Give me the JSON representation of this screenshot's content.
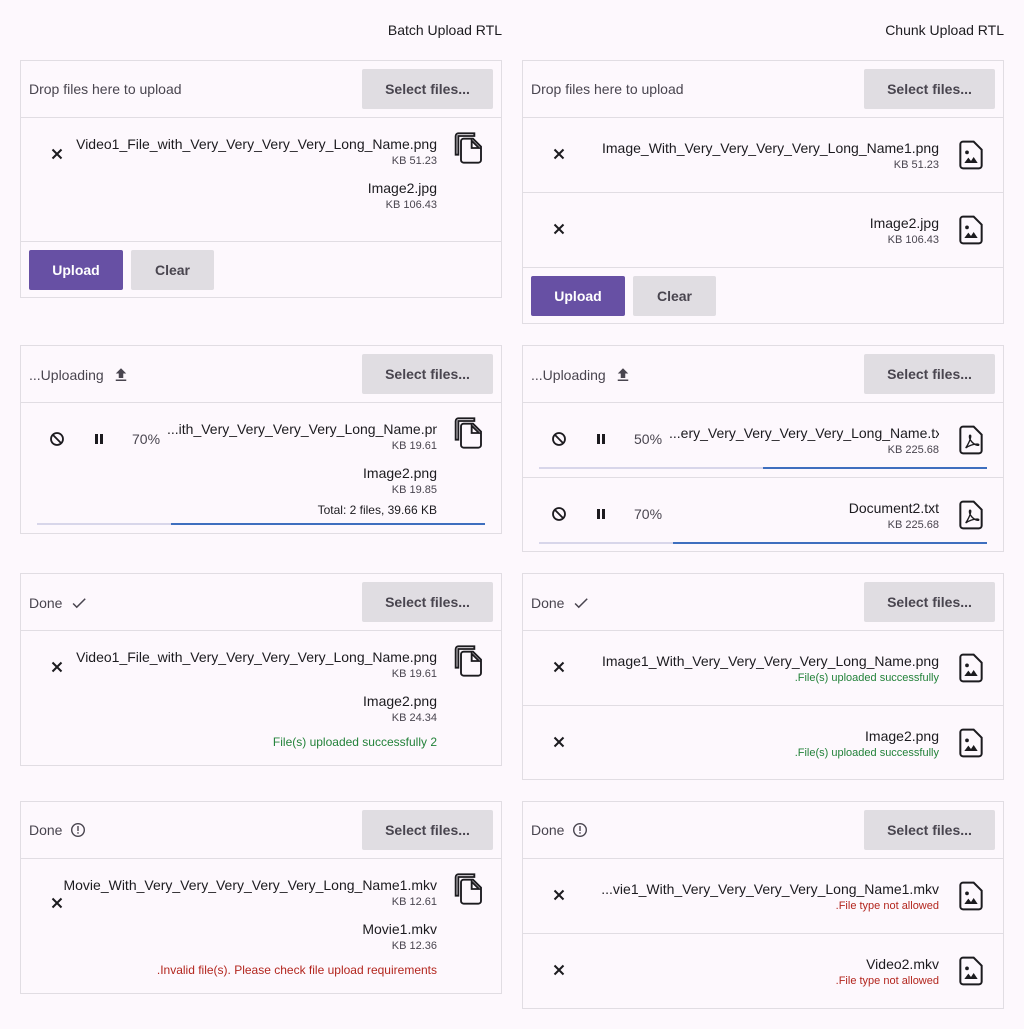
{
  "batch": {
    "title": "Batch Upload RTL",
    "select_label": "Select files...",
    "drop_label": "Drop files here to upload",
    "upload_label": "Upload",
    "clear_label": "Clear",
    "card1": {
      "files": [
        {
          "name": "Video1_File_with_Very_Very_Very_Very_Long_Name.png",
          "size": "KB 51.23"
        },
        {
          "name": "Image2.jpg",
          "size": "KB 106.43"
        }
      ]
    },
    "card2": {
      "status": "...Uploading",
      "percent": "70%",
      "progress": 0.7,
      "files": [
        {
          "name": "...ith_Very_Very_Very_Very_Long_Name.png",
          "size": "KB 19.61"
        },
        {
          "name": "Image2.png",
          "size": "KB 19.85"
        }
      ],
      "total": "Total: 2 files, 39.66 KB"
    },
    "card3": {
      "status": "Done",
      "files": [
        {
          "name": "Video1_File_with_Very_Very_Very_Very_Long_Name.png",
          "size": "KB 19.61"
        },
        {
          "name": "Image2.png",
          "size": "KB 24.34"
        }
      ],
      "summary": "File(s) uploaded successfully 2"
    },
    "card4": {
      "status": "Done",
      "files": [
        {
          "name": "Movie_With_Very_Very_Very_Very_Very_Long_Name1.mkv",
          "size": "KB 12.61"
        },
        {
          "name": "Movie1.mkv",
          "size": "KB 12.36"
        }
      ],
      "summary": ".Invalid file(s). Please check file upload requirements"
    }
  },
  "chunk": {
    "title": "Chunk Upload RTL",
    "select_label": "Select files...",
    "drop_label": "Drop files here to upload",
    "upload_label": "Upload",
    "clear_label": "Clear",
    "card1": {
      "files": [
        {
          "name": "Image_With_Very_Very_Very_Very_Long_Name1.png",
          "size": "KB 51.23"
        },
        {
          "name": "Image2.jpg",
          "size": "KB 106.43"
        }
      ]
    },
    "card2": {
      "status": "...Uploading",
      "files": [
        {
          "name": "...ery_Very_Very_Very_Very_Long_Name.txt",
          "size": "KB 225.68",
          "percent": "50%",
          "progress": 0.5
        },
        {
          "name": "Document2.txt",
          "size": "KB 225.68",
          "percent": "70%",
          "progress": 0.7
        }
      ]
    },
    "card3": {
      "status": "Done",
      "files": [
        {
          "name": "Image1_With_Very_Very_Very_Very_Long_Name.png",
          "message": ".File(s) uploaded successfully"
        },
        {
          "name": "Image2.png",
          "message": ".File(s) uploaded successfully"
        }
      ]
    },
    "card4": {
      "status": "Done",
      "files": [
        {
          "name": "...vie1_With_Very_Very_Very_Very_Long_Name1.mkv",
          "message": ".File type not allowed"
        },
        {
          "name": "Video2.mkv",
          "message": ".File type not allowed"
        }
      ]
    }
  },
  "colors": {
    "primary": "#6750a4",
    "progress": "#3e6fbf",
    "success": "#23823a",
    "error": "#b3261e"
  }
}
